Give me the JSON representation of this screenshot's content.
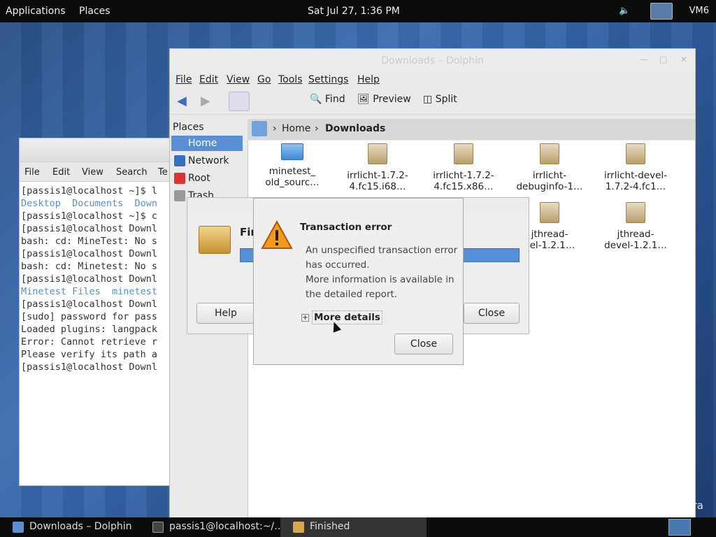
{
  "topbar": {
    "applications": "Applications",
    "places": "Places",
    "clock": "Sat Jul 27,  1:36 PM",
    "host": "VM6"
  },
  "terminal": {
    "menu": [
      "File",
      "Edit",
      "View",
      "Search",
      "Te"
    ],
    "lines": [
      {
        "text": "[passis1@localhost ~]$ l",
        "style": "normal"
      },
      {
        "text": "Desktop  Documents  Down",
        "style": "blue"
      },
      {
        "text": "[passis1@localhost ~]$ c",
        "style": "normal"
      },
      {
        "text": "[passis1@localhost Downl",
        "style": "normal"
      },
      {
        "text": "bash: cd: MineTest: No s",
        "style": "normal"
      },
      {
        "text": "[passis1@localhost Downl",
        "style": "normal"
      },
      {
        "text": "bash: cd: Minetest: No s",
        "style": "normal"
      },
      {
        "text": "[passis1@localhost Downl",
        "style": "normal"
      },
      {
        "text": "Minetest Files  minetest",
        "style": "blue"
      },
      {
        "text": "[passis1@localhost Downl",
        "style": "normal"
      },
      {
        "text": "[sudo] password for pass",
        "style": "normal"
      },
      {
        "text": "Loaded plugins: langpack",
        "style": "normal"
      },
      {
        "text": "Error: Cannot retrieve r",
        "style": "normal"
      },
      {
        "text": "Please verify its path a",
        "style": "normal"
      },
      {
        "text": "[passis1@localhost Downl",
        "style": "normal"
      }
    ]
  },
  "dolphin": {
    "title": "Downloads – Dolphin",
    "menu": [
      "File",
      "Edit",
      "View",
      "Go",
      "Tools",
      "Settings",
      "Help"
    ],
    "toolbar": {
      "find": "Find",
      "preview": "Preview",
      "split": "Split"
    },
    "places": {
      "header": "Places",
      "items": [
        {
          "label": "Home",
          "selected": true,
          "icon": "home-icon"
        },
        {
          "label": "Network",
          "selected": false,
          "icon": "network-icon"
        },
        {
          "label": "Root",
          "selected": false,
          "icon": "root-folder-icon"
        },
        {
          "label": "Trash",
          "selected": false,
          "icon": "trash-icon"
        }
      ]
    },
    "breadcrumb": {
      "home": "Home",
      "current": "Downloads"
    },
    "files": [
      {
        "line1": "minetest_",
        "line2": "old_sourc…",
        "type": "folder"
      },
      {
        "line1": "irrlicht-1.7.2-",
        "line2": "4.fc15.i68…",
        "type": "rpm"
      },
      {
        "line1": "irrlicht-1.7.2-",
        "line2": "4.fc15.x86…",
        "type": "rpm"
      },
      {
        "line1": "irrlicht-",
        "line2": "debuginfo-1…",
        "type": "rpm"
      },
      {
        "line1": "irrlicht-devel-",
        "line2": "1.7.2-4.fc1…",
        "type": "rpm"
      },
      {
        "line1": "jthread-",
        "line2": "vel-1.2.1…",
        "type": "rpm"
      },
      {
        "line1": "jthread-",
        "line2": "devel-1.2.1…",
        "type": "rpm"
      }
    ]
  },
  "finished_dialog": {
    "label": "Fir",
    "help": "Help",
    "close": "Close"
  },
  "error_dialog": {
    "title": "Transaction error",
    "message_lines": [
      "An unspecified transaction error",
      "has occurred.",
      "More information is available in",
      "the detailed report."
    ],
    "more_details": "More details",
    "close": "Close"
  },
  "taskbar": {
    "tasks": [
      {
        "label": "Downloads – Dolphin",
        "active": false
      },
      {
        "label": "passis1@localhost:~/…",
        "active": false
      },
      {
        "label": "Finished",
        "active": true
      }
    ]
  },
  "watermark": "fedora"
}
